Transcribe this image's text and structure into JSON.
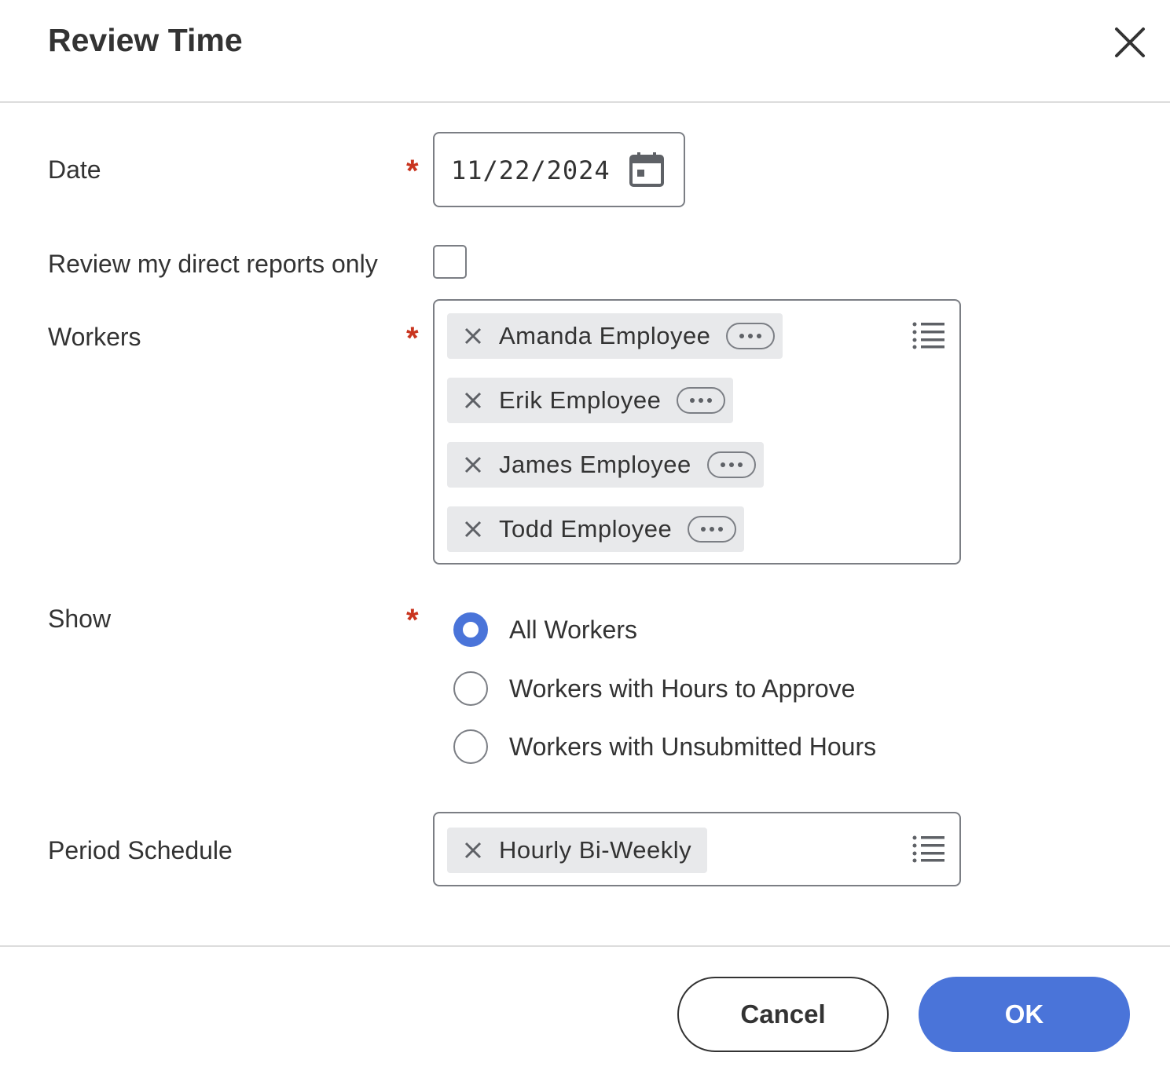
{
  "dialog": {
    "title": "Review Time"
  },
  "fields": {
    "date": {
      "label": "Date",
      "required": "*",
      "value": "11/22/2024"
    },
    "direct_reports": {
      "label": "Review my direct reports only",
      "checked": false
    },
    "workers": {
      "label": "Workers",
      "required": "*",
      "items": [
        "Amanda Employee",
        "Erik Employee",
        "James Employee",
        "Todd Employee"
      ]
    },
    "show": {
      "label": "Show",
      "required": "*",
      "options": [
        "All Workers",
        "Workers with Hours to Approve",
        "Workers with Unsubmitted Hours"
      ],
      "selected": "All Workers"
    },
    "period_schedule": {
      "label": "Period Schedule",
      "items": [
        "Hourly Bi-Weekly"
      ]
    }
  },
  "footer": {
    "cancel_label": "Cancel",
    "ok_label": "OK"
  },
  "colors": {
    "accent": "#4a74d9",
    "required": "#c9351f",
    "pill_bg": "#e8e9eb",
    "border": "#7b7e84"
  }
}
